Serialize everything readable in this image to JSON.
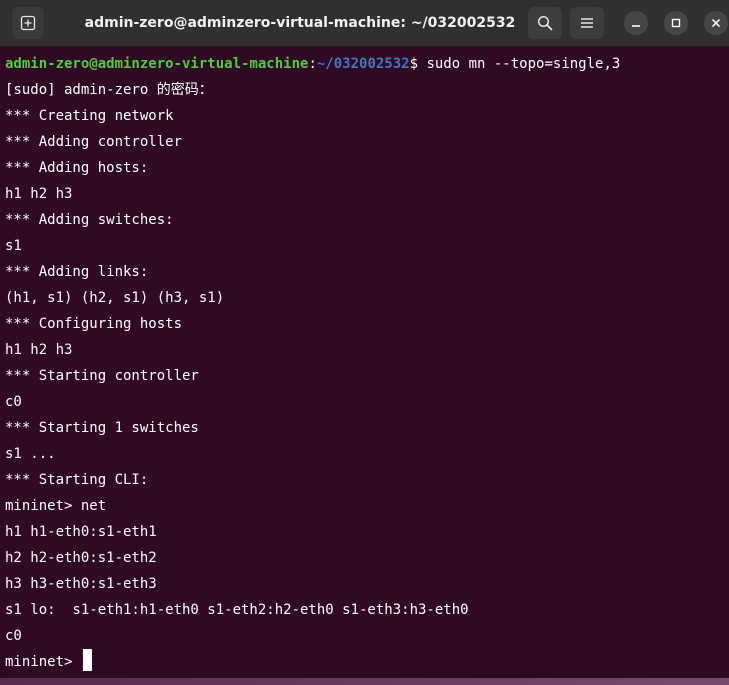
{
  "window": {
    "title": "admin-zero@adminzero-virtual-machine: ~/032002532"
  },
  "colors": {
    "background": "#300a24",
    "prompt_user": "#4ecd3a",
    "prompt_path": "#3e78c5",
    "text": "#ffffff",
    "titlebar": "#303030"
  },
  "icons": {
    "new_tab": "new-tab-icon",
    "search": "search-icon",
    "menu": "hamburger-menu-icon",
    "minimize": "minimize-icon",
    "maximize": "maximize-icon",
    "close": "close-icon"
  },
  "prompt": {
    "user_host": "admin-zero@adminzero-virtual-machine",
    "colon": ":",
    "path": "~/032002532",
    "symbol": "$ ",
    "command": "sudo mn --topo=single,3"
  },
  "output": [
    "[sudo] admin-zero 的密码：",
    "*** Creating network",
    "*** Adding controller",
    "*** Adding hosts:",
    "h1 h2 h3",
    "*** Adding switches:",
    "s1",
    "*** Adding links:",
    "(h1, s1) (h2, s1) (h3, s1)",
    "*** Configuring hosts",
    "h1 h2 h3",
    "*** Starting controller",
    "c0",
    "*** Starting 1 switches",
    "s1 ...",
    "*** Starting CLI:",
    "mininet> net",
    "h1 h1-eth0:s1-eth1",
    "h2 h2-eth0:s1-eth2",
    "h3 h3-eth0:s1-eth3",
    "s1 lo:  s1-eth1:h1-eth0 s1-eth2:h2-eth0 s1-eth3:h3-eth0",
    "c0"
  ],
  "current_prompt": "mininet> "
}
